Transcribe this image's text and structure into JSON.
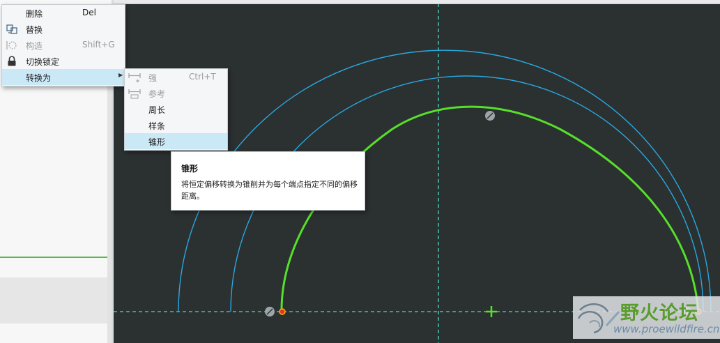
{
  "context_menu": {
    "items": [
      {
        "label": "删除",
        "shortcut": "Del",
        "icon": "",
        "disabled": false
      },
      {
        "label": "替换",
        "shortcut": "",
        "icon": "replace-icon",
        "disabled": false
      },
      {
        "label": "构造",
        "shortcut": "Shift+G",
        "icon": "construction-icon",
        "disabled": true
      },
      {
        "label": "切换锁定",
        "shortcut": "",
        "icon": "lock-icon",
        "disabled": false
      },
      {
        "label": "转换为",
        "shortcut": "",
        "icon": "",
        "disabled": false,
        "has_submenu": true,
        "highlighted": true
      }
    ]
  },
  "submenu": {
    "items": [
      {
        "label": "强",
        "shortcut": "Ctrl+T",
        "icon": "strong-dimension-icon",
        "disabled": true
      },
      {
        "label": "参考",
        "shortcut": "",
        "icon": "reference-dimension-icon",
        "disabled": true
      },
      {
        "label": "周长",
        "shortcut": "",
        "disabled": false
      },
      {
        "label": "样条",
        "shortcut": "",
        "disabled": false
      },
      {
        "label": "锥形",
        "shortcut": "",
        "disabled": false,
        "highlighted": true
      }
    ]
  },
  "tooltip": {
    "title": "锥形",
    "body": "将恒定偏移转换为锥削并为每个端点指定不同的偏移距离。"
  },
  "colors": {
    "canvas_bg": "#2b3031",
    "blue_arc": "#2aa8e0",
    "green_arc": "#56e02a",
    "centerline": "#4fd6c2",
    "menu_highlight": "#cbe8f6"
  },
  "watermark": {
    "title": "野火论坛",
    "url": "www.proewildfire.cn"
  }
}
